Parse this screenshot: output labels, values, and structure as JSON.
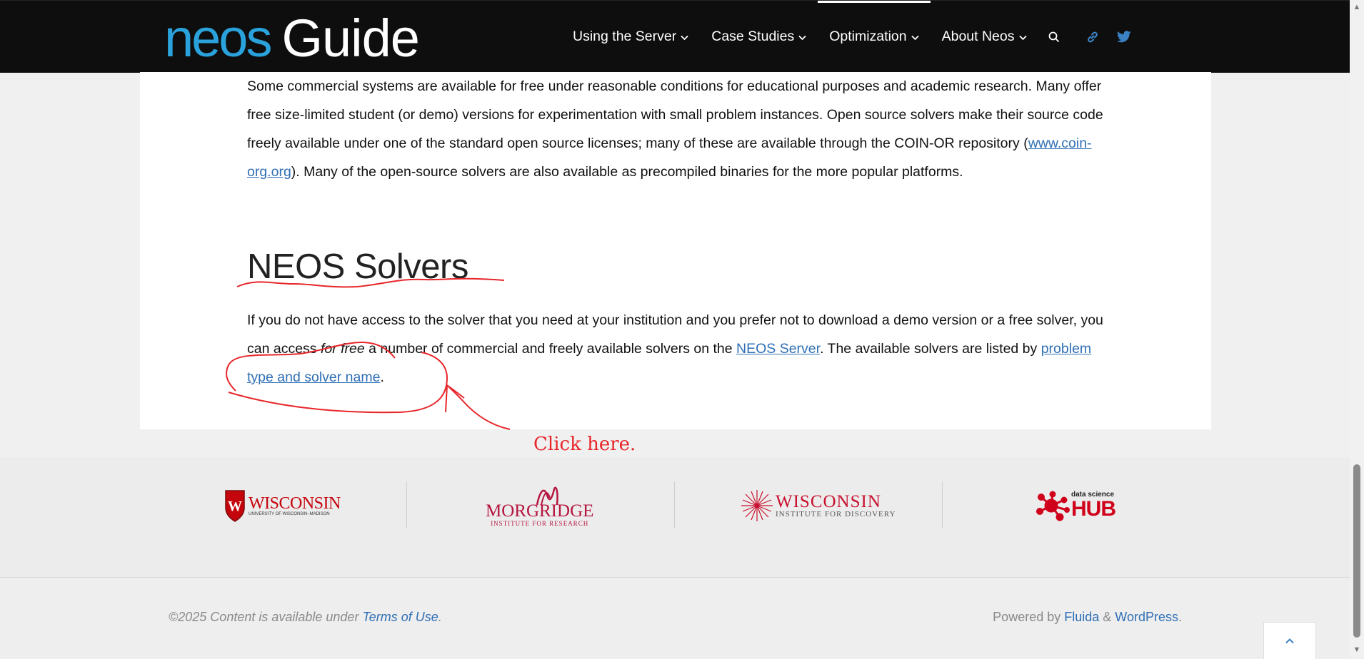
{
  "header": {
    "logo": {
      "part1": "neos",
      "part2": "Guide"
    },
    "nav": [
      {
        "label": "Using the Server"
      },
      {
        "label": "Case Studies"
      },
      {
        "label": "Optimization"
      },
      {
        "label": "About Neos"
      }
    ],
    "icons": [
      "search-icon",
      "link-icon",
      "twitter-icon"
    ],
    "colors": {
      "background": "#0e0e0e",
      "logo_accent": "#2aa3dd",
      "social": "#3b82c4"
    }
  },
  "content": {
    "intro": {
      "before_link": "Some commercial systems are available for free under reasonable conditions for educational purposes and academic research. Many offer free size-limited student (or demo) versions for experimentation with small problem instances. Open source solvers make their source code freely available under one of the standard open source licenses; many of these are available through the COIN-OR repository (",
      "link": "www.coin-org.org",
      "after_link": "). Many of the open-source solvers are also available as precompiled binaries for the more popular platforms."
    },
    "heading": "NEOS Solvers",
    "solvers_para": {
      "part1": "If you do not have access to the solver that you need at your institution and you prefer not to download a demo version or a free solver, you can access ",
      "emphasis": "for free",
      "part2": " a number of commercial and freely available solvers on the ",
      "link1": "NEOS Server",
      "part3": ". The available solvers are listed by ",
      "link2": "problem type and solver name",
      "part4": "."
    },
    "link_color": "#2f6fb5"
  },
  "annotation": {
    "note": "Click here.",
    "color": "#e8262a"
  },
  "partners": {
    "wisconsin": {
      "name": "WISCONSIN",
      "sub": "UNIVERSITY OF WISCONSIN–MADISON",
      "crest": "W"
    },
    "morgridge": {
      "name": "MORGRIDGE",
      "sub": "INSTITUTE FOR RESEARCH"
    },
    "wid": {
      "name": "WISCONSIN",
      "sub": "INSTITUTE FOR DISCOVERY"
    },
    "hub": {
      "top": "data science",
      "name": "HUB"
    }
  },
  "footer": {
    "copyright_prefix": "©2025 Content is available under ",
    "terms_link": "Terms of Use",
    "copyright_suffix": ".",
    "powered_prefix": "Powered by ",
    "fluida_link": "Fluida",
    "amp": " & ",
    "wordpress_link": "WordPress",
    "powered_suffix": "."
  }
}
